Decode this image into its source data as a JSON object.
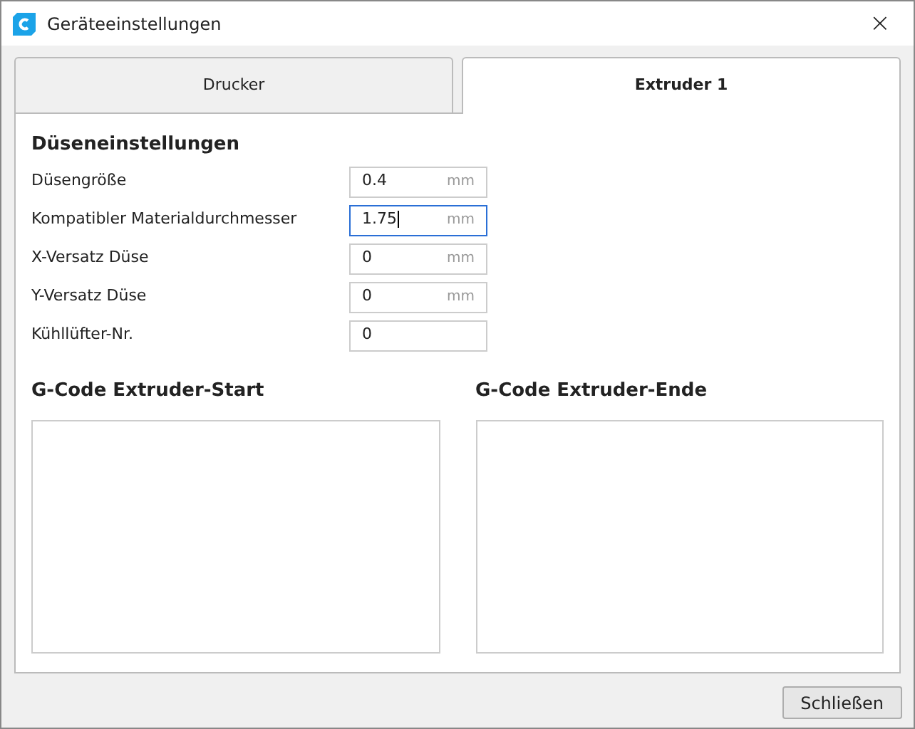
{
  "window": {
    "title": "Geräteeinstellungen",
    "close": "×"
  },
  "tabs": [
    {
      "label": "Drucker",
      "selected": false
    },
    {
      "label": "Extruder 1",
      "selected": true
    }
  ],
  "section": {
    "title": "Düseneinstellungen"
  },
  "fields": [
    {
      "label": "Düsengröße",
      "value": "0.4",
      "unit": "mm",
      "focused": false
    },
    {
      "label": "Kompatibler Materialdurchmesser",
      "value": "1.75",
      "unit": "mm",
      "focused": true
    },
    {
      "label": "X-Versatz Düse",
      "value": "0",
      "unit": "mm",
      "focused": false
    },
    {
      "label": "Y-Versatz Düse",
      "value": "0",
      "unit": "mm",
      "focused": false
    },
    {
      "label": "Kühllüfter-Nr.",
      "value": "0",
      "focused": false
    }
  ],
  "gcode": [
    {
      "title": "G-Code Extruder-Start"
    },
    {
      "title": "G-Code Extruder-Ende"
    }
  ],
  "buttons": [
    "Schließen"
  ]
}
